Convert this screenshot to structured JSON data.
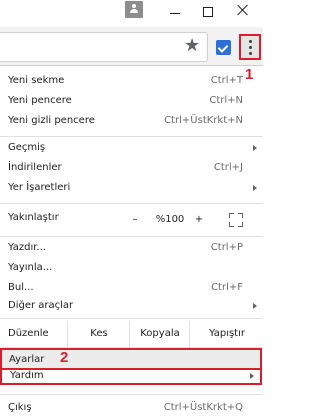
{
  "menu": {
    "items": [
      {
        "label": "Yeni sekme",
        "shortcut": "Ctrl+T"
      },
      {
        "label": "Yeni pencere",
        "shortcut": "Ctrl+N"
      },
      {
        "label": "Yeni gizli pencere",
        "shortcut": "Ctrl+ÜstKrkt+N"
      },
      {
        "label": "Geçmiş",
        "shortcut": ""
      },
      {
        "label": "İndirilenler",
        "shortcut": "Ctrl+J"
      },
      {
        "label": "Yer İşaretleri",
        "shortcut": ""
      },
      {
        "label": "Yazdır...",
        "shortcut": "Ctrl+P"
      },
      {
        "label": "Yayınla...",
        "shortcut": ""
      },
      {
        "label": "Bul...",
        "shortcut": "Ctrl+F"
      },
      {
        "label": "Diğer araçlar",
        "shortcut": ""
      },
      {
        "label": "Ayarlar",
        "shortcut": ""
      },
      {
        "label": "Yardım",
        "shortcut": ""
      },
      {
        "label": "Çıkış",
        "shortcut": "Ctrl+ÜstKrkt+Q"
      }
    ],
    "zoom": {
      "label": "Yakınlaştır",
      "minus": "–",
      "value": "%100",
      "plus": "+"
    },
    "edit": {
      "label": "Düzenle",
      "cut": "Kes",
      "copy": "Kopyala",
      "paste": "Yapıştır"
    }
  },
  "annotations": {
    "step1": "1",
    "step2": "2"
  },
  "colors": {
    "annotation": "#d6202f",
    "extension": "#2d6fd6"
  },
  "toolbar": {
    "star_icon": "★"
  }
}
